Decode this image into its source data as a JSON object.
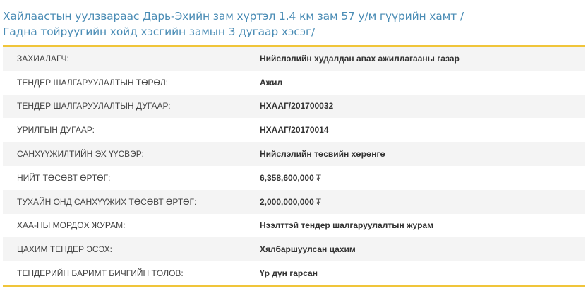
{
  "page": {
    "title": "Хайлаастын уулзвараас Дарь-Эхийн зам хүртэл 1.4 км зам 57 у/м гүүрийн хамт /Гадна тойруугийн хойд хэсгийн замын 3 дугаар хэсэг/"
  },
  "details": {
    "rows": [
      {
        "label": "ЗАХИАЛАГЧ:",
        "value": "Нийслэлийн худалдан авах ажиллагааны газар",
        "currency": ""
      },
      {
        "label": "ТЕНДЕР ШАЛГАРУУЛАЛТЫН ТӨРӨЛ:",
        "value": "Ажил",
        "currency": ""
      },
      {
        "label": "ТЕНДЕР ШАЛГАРУУЛАЛТЫН ДУГААР:",
        "value": "НХААГ/201700032",
        "currency": ""
      },
      {
        "label": "УРИЛГЫН ДУГААР:",
        "value": "НХААГ/20170014",
        "currency": ""
      },
      {
        "label": "САНХҮҮЖИЛТИЙН ЭХ ҮҮСВЭР:",
        "value": "Нийслэлийн төсвийн хөрөнгө",
        "currency": ""
      },
      {
        "label": "НИЙТ ТӨСӨВТ ӨРТӨГ:",
        "value": "6,358,600,000",
        "currency": "₮"
      },
      {
        "label": "ТУХАЙН ОНД САНХҮҮЖИХ ТӨСӨВТ ӨРТӨГ:",
        "value": "2,000,000,000",
        "currency": "₮"
      },
      {
        "label": "ХАА-НЫ МӨРДӨХ ЖУРАМ:",
        "value": "Нээлттэй тендер шалгаруулалтын журам",
        "currency": ""
      },
      {
        "label": "ЦАХИМ ТЕНДЕР ЭСЭХ:",
        "value": "Хялбаршуулсан цахим",
        "currency": ""
      },
      {
        "label": "ТЕНДЕРИЙН БАРИМТ БИЧГИЙН ТӨЛӨВ:",
        "value": "Үр дүн гарсан",
        "currency": ""
      }
    ]
  },
  "colors": {
    "title": "#4a8cb5",
    "border_accent": "#f0c53a",
    "row_stripe": "#f4f4f4"
  }
}
